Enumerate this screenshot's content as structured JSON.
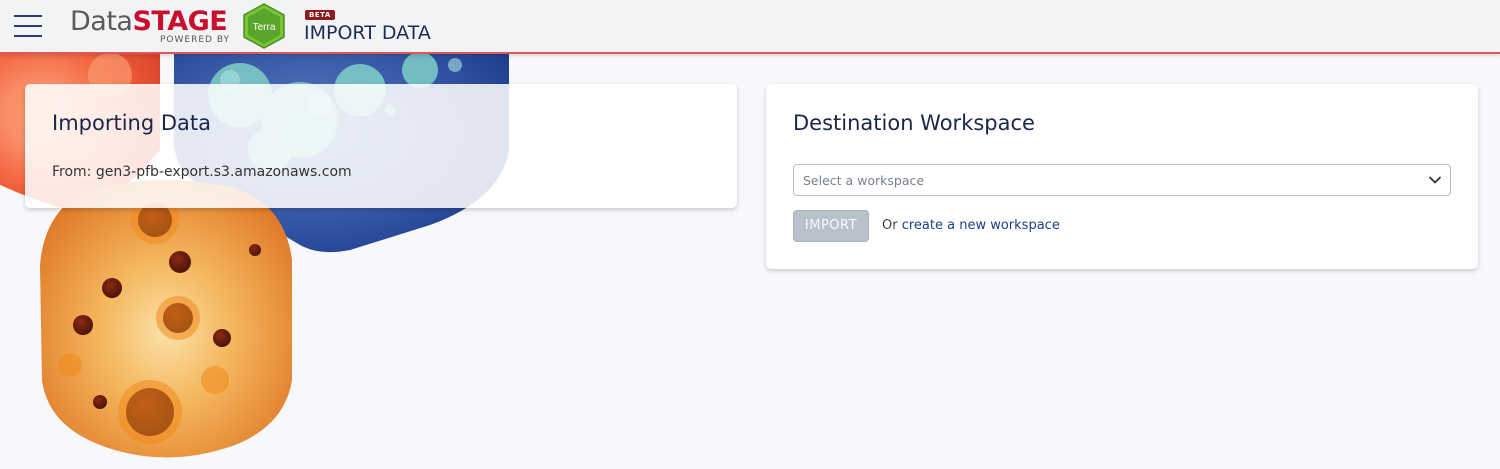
{
  "header": {
    "logo_data": "Data",
    "logo_stage": "STAGE",
    "logo_powered": "POWERED BY",
    "terra_label": "Terra",
    "beta": "BETA",
    "title": "IMPORT DATA",
    "accent_color": "#c8102e"
  },
  "importing": {
    "title": "Importing Data",
    "from_label": "From:",
    "source": "gen3-pfb-export.s3.amazonaws.com"
  },
  "destination": {
    "title": "Destination Workspace",
    "select_placeholder": "Select a workspace",
    "import_button": "IMPORT",
    "or_text": "Or",
    "create_link": "create a new workspace"
  },
  "icons": {
    "menu": "hamburger-icon",
    "dropdown": "chevron-down-icon"
  }
}
